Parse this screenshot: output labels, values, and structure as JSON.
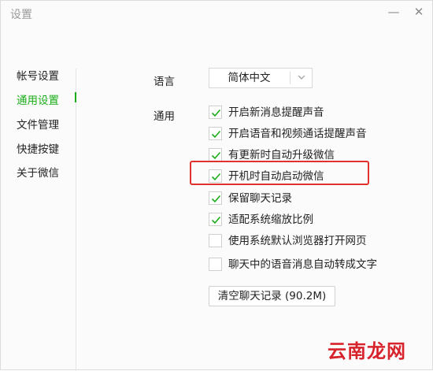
{
  "window": {
    "title": "设置",
    "minimize_glyph": "—",
    "close_glyph": "✕"
  },
  "sidebar": {
    "items": [
      {
        "label": "帐号设置",
        "active": false
      },
      {
        "label": "通用设置",
        "active": true
      },
      {
        "label": "文件管理",
        "active": false
      },
      {
        "label": "快捷按键",
        "active": false
      },
      {
        "label": "关于微信",
        "active": false
      }
    ]
  },
  "main": {
    "language_label": "语言",
    "language_value": "简体中文",
    "general_label": "通用",
    "options": [
      {
        "label": "开启新消息提醒声音",
        "checked": true
      },
      {
        "label": "开启语音和视频通话提醒声音",
        "checked": true
      },
      {
        "label": "有更新时自动升级微信",
        "checked": true
      },
      {
        "label": "开机时自动启动微信",
        "checked": true
      },
      {
        "label": "保留聊天记录",
        "checked": true
      },
      {
        "label": "适配系统缩放比例",
        "checked": true
      },
      {
        "label": "使用系统默认浏览器打开网页",
        "checked": false
      },
      {
        "label": "聊天中的语音消息自动转成文字",
        "checked": false
      }
    ],
    "clear_button": "清空聊天记录 (90.2M)"
  },
  "watermark": "云南龙网",
  "colors": {
    "accent": "#1aad19",
    "highlight": "#e0322c",
    "watermark": "#d6232c"
  }
}
